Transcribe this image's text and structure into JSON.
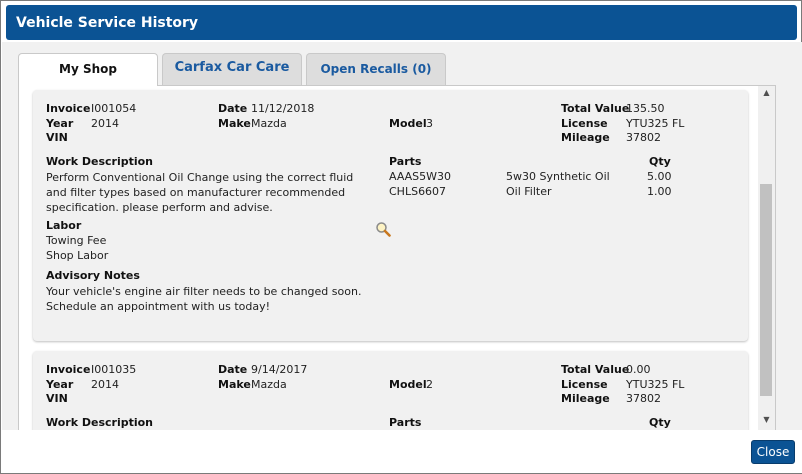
{
  "dialog": {
    "title": "Vehicle Service History"
  },
  "tabs": [
    {
      "label": "My Shop"
    },
    {
      "label": "Carfax Car Care"
    },
    {
      "label": "Open Recalls (0)"
    }
  ],
  "labels": {
    "invoice": "Invoice",
    "date": "Date",
    "total_value": "Total Value",
    "year": "Year",
    "make": "Make",
    "model": "Model",
    "license": "License",
    "vin": "VIN",
    "mileage": "Mileage",
    "work_description": "Work Description",
    "parts": "Parts",
    "qty": "Qty",
    "labor": "Labor",
    "advisory_notes": "Advisory Notes"
  },
  "records": [
    {
      "invoice": "I001054",
      "date": "11/12/2018",
      "total_value": "135.50",
      "year": "2014",
      "make": "Mazda",
      "model": "3",
      "license": "YTU325 FL",
      "vin": "",
      "mileage": "37802",
      "work_description": "Perform Conventional Oil Change using the correct fluid and filter types based on manufacturer recommended specification. please perform and advise.",
      "parts": [
        {
          "code": "AAAS5W30",
          "name": "5w30 Synthetic Oil",
          "qty": "5.00"
        },
        {
          "code": "CHLS6607",
          "name": "Oil Filter",
          "qty": "1.00"
        }
      ],
      "labor": [
        "Towing Fee",
        "Shop Labor"
      ],
      "advisory_notes": "Your vehicle's engine air filter needs to be changed soon. Schedule an appointment with us today!",
      "detail_icon": "magnifier-icon"
    },
    {
      "invoice": "I001035",
      "date": "9/14/2017",
      "total_value": "0.00",
      "year": "2014",
      "make": "Mazda",
      "model": "2",
      "license": "YTU325 FL",
      "vin": "",
      "mileage": "37802"
    }
  ],
  "footer": {
    "close_label": "Close"
  },
  "colors": {
    "primary": "#0b5394",
    "tab_link": "#1a5aa0",
    "card_bg": "#f1f1f1"
  }
}
